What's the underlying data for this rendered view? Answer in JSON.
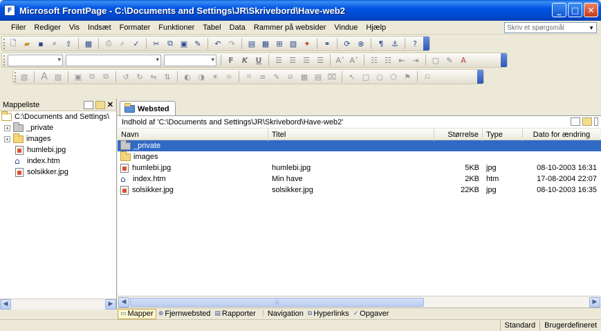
{
  "window": {
    "app_icon_letter": "F",
    "title": "Microsoft FrontPage - C:\\Documents and Settings\\JR\\Skrivebord\\Have-web2",
    "buttons": {
      "minimize": "_",
      "maximize": "□",
      "close": "✕"
    }
  },
  "menu": {
    "items": [
      "Filer",
      "Rediger",
      "Vis",
      "Indsæt",
      "Formater",
      "Funktioner",
      "Tabel",
      "Data",
      "Rammer på websider",
      "Vindue",
      "Hjælp"
    ],
    "help_placeholder": "Skriv et spørgsmål"
  },
  "toolbars": {
    "standard_icons": [
      "new-page-icon",
      "open-icon",
      "save-icon",
      "search-icon",
      "publish-icon",
      "view-icon",
      "print-icon",
      "print-preview-icon",
      "spelling-icon",
      "cut-icon",
      "copy-icon",
      "paste-icon",
      "format-painter-icon",
      "undo-icon",
      "redo-icon",
      "web-component-icon",
      "insert-table-icon",
      "insert-layer-icon",
      "insert-picture-icon",
      "drawing-icon",
      "hyperlink-icon",
      "refresh-icon",
      "stop-icon",
      "show-all-icon",
      "help-icon"
    ],
    "formatting": {
      "bold": "F",
      "italic": "K",
      "underline": "U"
    }
  },
  "folder_pane": {
    "title": "Mappeliste",
    "root": "C:\\Documents and Settings\\",
    "items": [
      {
        "label": "_private",
        "kind": "folder-gray",
        "expander": "+"
      },
      {
        "label": "images",
        "kind": "folder",
        "expander": "+"
      },
      {
        "label": "humlebi.jpg",
        "kind": "image"
      },
      {
        "label": "index.htm",
        "kind": "home"
      },
      {
        "label": "solsikker.jpg",
        "kind": "image"
      }
    ]
  },
  "main": {
    "tab_label": "Websted",
    "path_label": "Indhold af 'C:\\Documents and Settings\\JR\\Skrivebord\\Have-web2'",
    "columns": {
      "name": "Navn",
      "title": "Titel",
      "size": "Størrelse",
      "type": "Type",
      "date": "Dato for ændring"
    },
    "rows": [
      {
        "name": "_private",
        "title": "",
        "size": "",
        "type": "",
        "date": "",
        "kind": "folder-gray",
        "selected": true
      },
      {
        "name": "images",
        "title": "",
        "size": "",
        "type": "",
        "date": "",
        "kind": "folder",
        "selected": false
      },
      {
        "name": "humlebi.jpg",
        "title": "humlebi.jpg",
        "size": "5KB",
        "type": "jpg",
        "date": "08-10-2003 16:31",
        "kind": "image",
        "selected": false
      },
      {
        "name": "index.htm",
        "title": "Min have",
        "size": "2KB",
        "type": "htm",
        "date": "17-08-2004 22:07",
        "kind": "home",
        "selected": false
      },
      {
        "name": "solsikker.jpg",
        "title": "solsikker.jpg",
        "size": "22KB",
        "type": "jpg",
        "date": "08-10-2003 16:35",
        "kind": "image",
        "selected": false
      }
    ]
  },
  "views_bar": {
    "items": [
      {
        "label": "Mapper",
        "icon": "folders-icon",
        "glyph": "▭",
        "active": true
      },
      {
        "label": "Fjernwebsted",
        "icon": "remote-site-icon",
        "glyph": "⊕",
        "active": false
      },
      {
        "label": "Rapporter",
        "icon": "reports-icon",
        "glyph": "▤",
        "active": false
      },
      {
        "label": "Navigation",
        "icon": "navigation-icon",
        "glyph": "⋮",
        "active": false
      },
      {
        "label": "Hyperlinks",
        "icon": "hyperlinks-icon",
        "glyph": "⧉",
        "active": false
      },
      {
        "label": "Opgaver",
        "icon": "tasks-icon",
        "glyph": "✓",
        "active": false
      }
    ]
  },
  "status": {
    "left_panel": "Standard",
    "right_panel": "Brugerdefineret"
  }
}
